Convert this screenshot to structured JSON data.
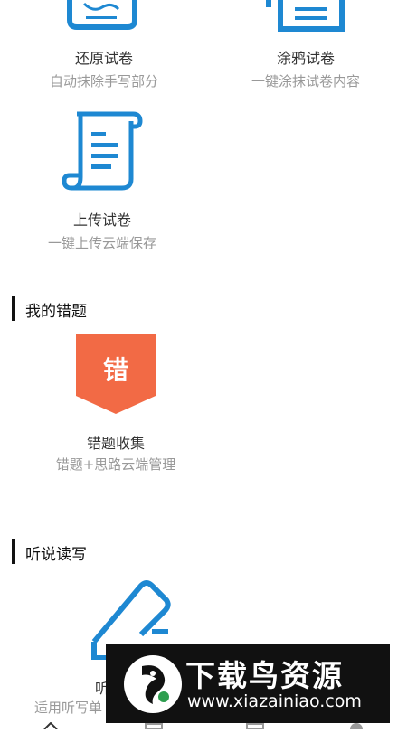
{
  "tools": [
    {
      "title": "还原试卷",
      "subtitle": "自动抹除手写部分",
      "icon": "restore-paper-icon"
    },
    {
      "title": "涂鸦试卷",
      "subtitle": "一键涂抹试卷内容",
      "icon": "doodle-paper-icon"
    },
    {
      "title": "上传试卷",
      "subtitle": "一键上传云端保存",
      "icon": "upload-paper-icon"
    }
  ],
  "sections": {
    "mistakes": {
      "title": "我的错题",
      "item": {
        "badge": "错",
        "title": "错题收集",
        "subtitle": "错题+思路云端管理",
        "badge_color": "#F26A45"
      }
    },
    "listen_speak": {
      "title": "听说读写",
      "item": {
        "title": "听",
        "subtitle": "适用听写单",
        "icon": "pencil-icon"
      }
    }
  },
  "watermark": {
    "name": "下载鸟资源",
    "url": "www.xiazainiao.com"
  },
  "colors": {
    "accent_blue": "#1E88D2",
    "badge_orange": "#F26A45"
  }
}
